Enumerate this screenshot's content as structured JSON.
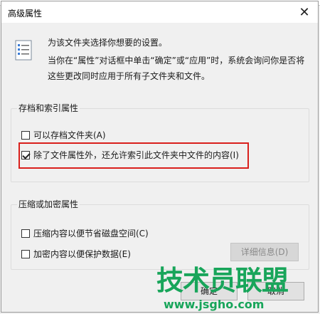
{
  "dialog": {
    "title": "高级属性",
    "close_glyph": "✕",
    "description_line1": "为该文件夹选择你想要的设置。",
    "description_line2": "当你在“属性”对话框中单击“确定”或“应用”时，系统会询问你是否将这些更改同时应用于所有子文件夹和文件。"
  },
  "archive_group": {
    "title": "存档和索引属性",
    "archive_label": "可以存档文件夹(A)",
    "archive_checked": false,
    "index_label": "除了文件属性外，还允许索引此文件夹中文件的内容(I)",
    "index_checked": true
  },
  "compress_group": {
    "title": "压缩或加密属性",
    "compress_label": "压缩内容以便节省磁盘空间(C)",
    "encrypt_label": "加密内容以便保护数据(E)",
    "details_button": "详细信息(D)"
  },
  "buttons": {
    "ok": "确定",
    "cancel": "取消"
  },
  "watermark": {
    "brand": "技术员联盟",
    "url": "www.jsgho.com"
  },
  "colors": {
    "highlight": "#d9201c",
    "watermark": "#18a55a"
  },
  "icons": {
    "doc_icon": "properties-document-icon",
    "close": "close-icon"
  }
}
